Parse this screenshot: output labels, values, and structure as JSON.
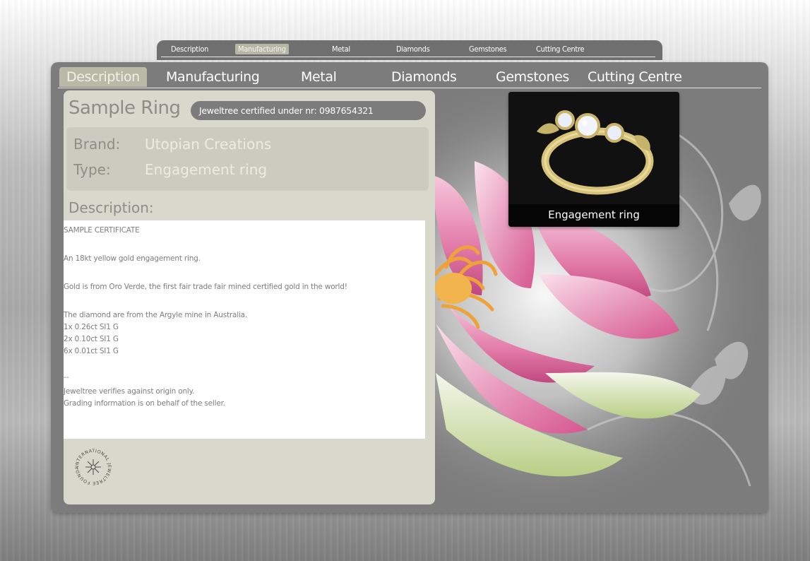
{
  "small_tabs": [
    {
      "label": "Description",
      "active": false
    },
    {
      "label": "Manufacturing",
      "active": true
    },
    {
      "label": "Metal",
      "active": false
    },
    {
      "label": "Diamonds",
      "active": false
    },
    {
      "label": "Gemstones",
      "active": false
    },
    {
      "label": "Cutting Centre",
      "active": false
    }
  ],
  "main_tabs": [
    {
      "label": "Description",
      "active": true
    },
    {
      "label": "Manufacturing",
      "active": false
    },
    {
      "label": "Metal",
      "active": false
    },
    {
      "label": "Diamonds",
      "active": false
    },
    {
      "label": "Gemstones",
      "active": false
    },
    {
      "label": "Cutting Centre",
      "active": false
    }
  ],
  "product": {
    "title": "Sample Ring",
    "certification": "Jeweltree certified under nr: 0987654321",
    "brand_label": "Brand:",
    "brand_value": "Utopian Creations",
    "type_label": "Type:",
    "type_value": "Engagement ring"
  },
  "description": {
    "heading": "Description:",
    "lines": [
      "SAMPLE CERTIFICATE",
      "",
      "An 18kt yellow gold engagement ring.",
      "",
      "Gold is from Oro Verde, the first fair trade fair mined certified gold in the world!",
      "",
      "The diamond are from the Argyle mine in Australia.",
      "1x 0.26ct SI1 G",
      "2x 0.10ct SI1 G",
      "6x 0.01ct SI1 G",
      "",
      "--",
      "Jeweltree verifies against origin only.",
      "Grading information is on behalf of the seller."
    ]
  },
  "seal": {
    "text": "INTERNATIONAL JEWELTREE FOUNDATION",
    "icon": "seal-icon"
  },
  "photo": {
    "caption": "Engagement ring",
    "icon": "ring-photo"
  },
  "colors": {
    "panel": "#7c7c7c",
    "card": "#d8d8cc",
    "active_tab": "#b9b9a8",
    "value_text": "#ececdf",
    "label_text": "#8e8e86"
  }
}
